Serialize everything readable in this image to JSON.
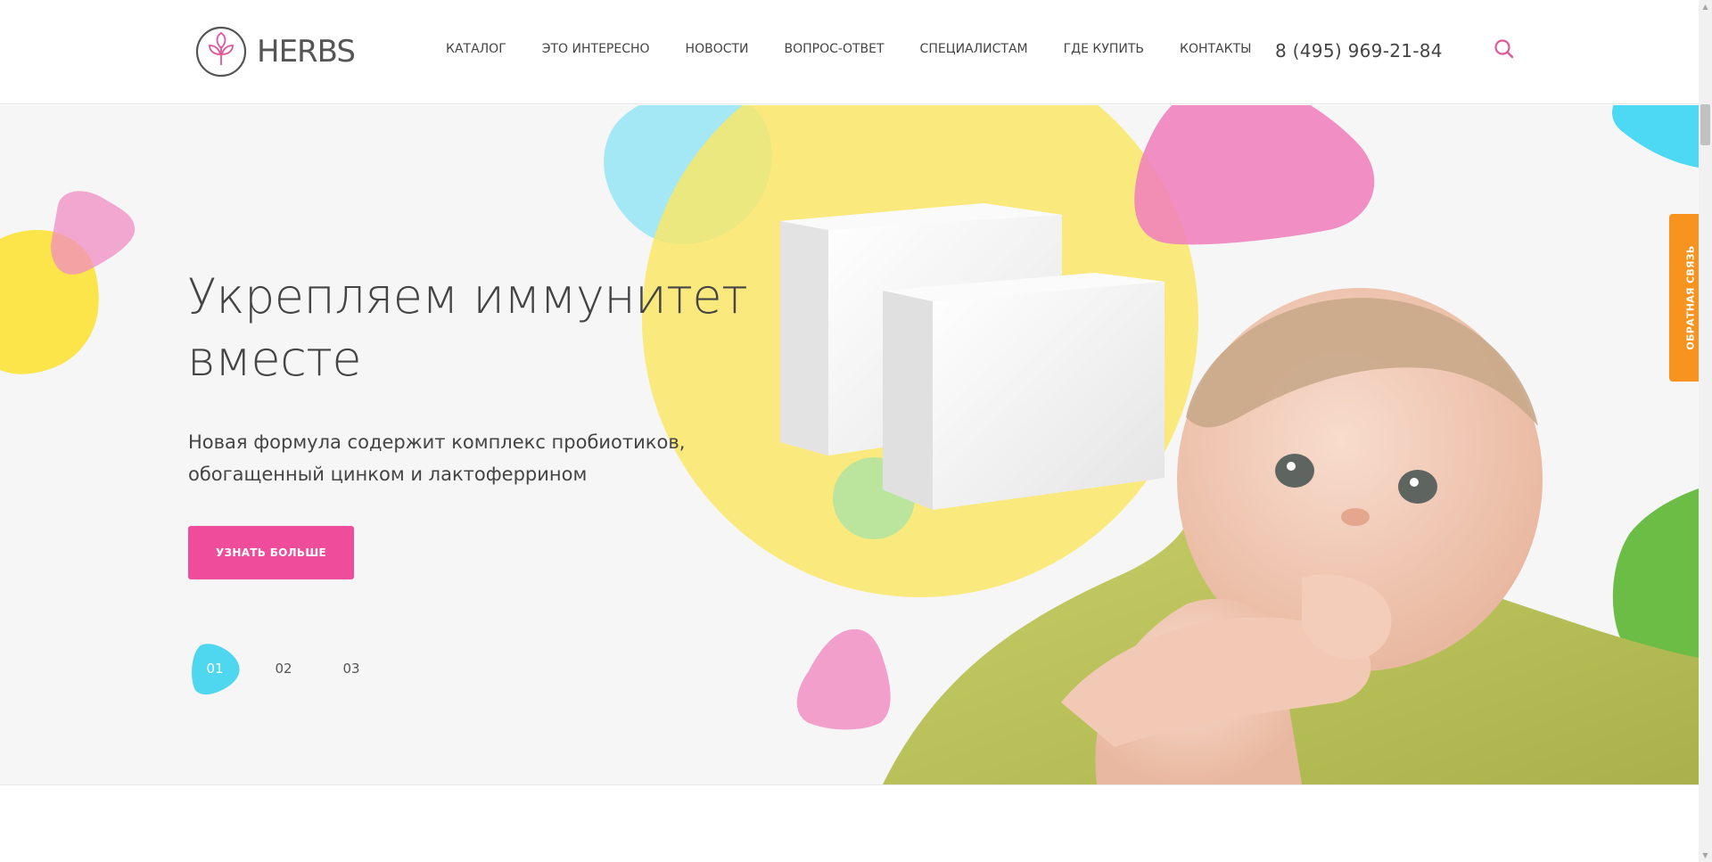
{
  "header": {
    "logo_text": "HERBS",
    "nav": [
      {
        "label": "Каталог"
      },
      {
        "label": "Это интересно"
      },
      {
        "label": "Новости"
      },
      {
        "label": "Вопрос-ответ"
      },
      {
        "label": "Специалистам"
      },
      {
        "label": "Где купить"
      },
      {
        "label": "Контакты"
      }
    ],
    "phone": "8 (495) 969-21-84",
    "search_icon": "search-icon"
  },
  "hero": {
    "title": "Укрепляем иммунитет вместе",
    "subtitle": "Новая формула содержит комплекс пробиотиков, обогащенный цинком и лактоферрином",
    "button_label": "Узнать больше",
    "slides": [
      {
        "label": "01",
        "active": true
      },
      {
        "label": "02",
        "active": false
      },
      {
        "label": "03",
        "active": false
      }
    ]
  },
  "feedback_label": "Обратная связь",
  "colors": {
    "accent_pink": "#ef4d9c",
    "accent_cyan": "#4fd7ef",
    "accent_yellow": "#fbe54a",
    "accent_green": "#6cbd45",
    "feedback_orange": "#f7931e",
    "logo_pink": "#e2569b"
  }
}
